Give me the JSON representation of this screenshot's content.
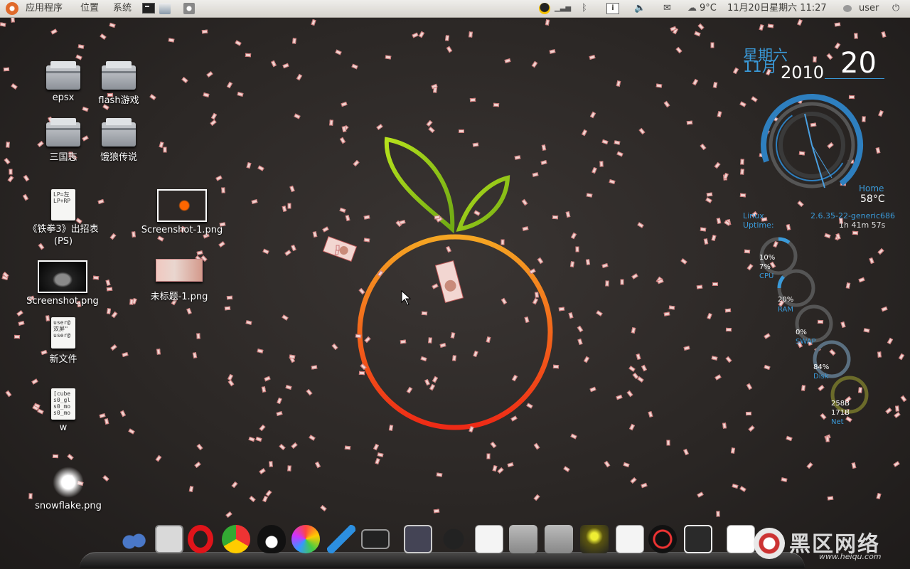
{
  "panel": {
    "menus": [
      "应用程序",
      "位置",
      "系统"
    ],
    "weather": "9°C",
    "datetime": "11月20日星期六 11:27",
    "user": "user"
  },
  "desktop": {
    "icons": [
      {
        "label": "epsx",
        "kind": "folder"
      },
      {
        "label": "flash游戏",
        "kind": "folder"
      },
      {
        "label": "三国志",
        "kind": "folder"
      },
      {
        "label": "饿狼传说",
        "kind": "folder"
      },
      {
        "label": "《铁拳3》出招表\n(PS)",
        "kind": "document",
        "preview": "LP=左\nLP+RP"
      },
      {
        "label": "Screenshot-1.png",
        "kind": "image"
      },
      {
        "label": "Screenshot.png",
        "kind": "image"
      },
      {
        "label": "未标题-1.png",
        "kind": "image"
      },
      {
        "label": "新文件",
        "kind": "document",
        "preview": "user@\n双屏\"\nuser@"
      },
      {
        "label": "w",
        "kind": "document",
        "preview": "[cube\ns0_gl\ns0_mo\ns0_mo"
      },
      {
        "label": "snowflake.png",
        "kind": "image"
      }
    ]
  },
  "widgets": {
    "calendar": {
      "weekday": "星期六",
      "month": "11月",
      "year": "2010",
      "day": "20"
    },
    "temp": {
      "label": "Home",
      "value": "58°C"
    },
    "system": {
      "os": "Linux",
      "kernel": "2.6.35-22-generic686",
      "uptime_label": "Uptime:",
      "uptime": "1h 41m 57s"
    },
    "meters": [
      {
        "value": "10%",
        "value2": "7%",
        "label": "CPU",
        "color": "#3a9ad9"
      },
      {
        "value": "20%",
        "label": "RAM",
        "color": "#3a9ad9"
      },
      {
        "value": "0%",
        "label": "SWAP",
        "color": "#3a9ad9"
      },
      {
        "value": "84%",
        "label": "Disk",
        "color": "#5a6f80"
      },
      {
        "value": "258B",
        "value2": "171B",
        "label": "Net",
        "color": "#6b6b2a"
      }
    ]
  },
  "wallpaper": {
    "leaf_color": "#9bd11b",
    "ring_top": "#f5a623",
    "ring_bottom": "#ee2a16"
  },
  "dock": {
    "items": [
      "finder-icon",
      "calculator-icon",
      "opera-icon",
      "chrome-icon",
      "qq-icon",
      "pinwheel-icon",
      "feather-icon",
      "screen-icon",
      "window-icon",
      "gnome-foot-icon",
      "menu-doc-icon",
      "folder-icon",
      "download-folder-icon",
      "image-icon",
      "text-editor-icon",
      "speedometer-icon",
      "trash-icon",
      "screenshot-thumb-icon"
    ]
  },
  "watermark": {
    "brand": "黑区网络",
    "url": "www.heiqu.com"
  }
}
